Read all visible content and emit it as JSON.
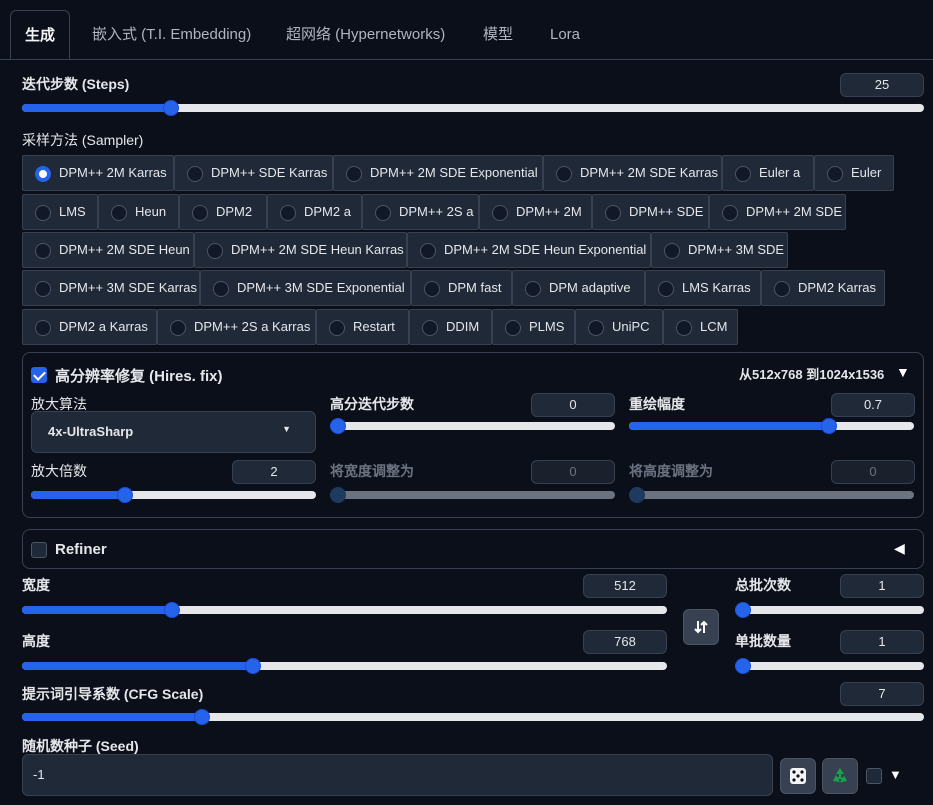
{
  "tabs": [
    {
      "label": "生成",
      "active": true
    },
    {
      "label": "嵌入式 (T.I. Embedding)"
    },
    {
      "label": "超网络 (Hypernetworks)"
    },
    {
      "label": "模型"
    },
    {
      "label": "Lora"
    }
  ],
  "steps": {
    "label": "迭代步数 (Steps)",
    "value": "25",
    "fraction": 0.165
  },
  "sampler": {
    "label": "采样方法 (Sampler)",
    "selected": "DPM++ 2M Karras",
    "options": [
      "DPM++ 2M Karras",
      "DPM++ SDE Karras",
      "DPM++ 2M SDE Exponential",
      "DPM++ 2M SDE Karras",
      "Euler a",
      "Euler",
      "LMS",
      "Heun",
      "DPM2",
      "DPM2 a",
      "DPM++ 2S a",
      "DPM++ 2M",
      "DPM++ SDE",
      "DPM++ 2M SDE",
      "DPM++ 2M SDE Heun",
      "DPM++ 2M SDE Heun Karras",
      "DPM++ 2M SDE Heun Exponential",
      "DPM++ 3M SDE",
      "DPM++ 3M SDE Karras",
      "DPM++ 3M SDE Exponential",
      "DPM fast",
      "DPM adaptive",
      "LMS Karras",
      "DPM2 Karras",
      "DPM2 a Karras",
      "DPM++ 2S a Karras",
      "Restart",
      "DDIM",
      "PLMS",
      "UniPC",
      "LCM"
    ]
  },
  "hires": {
    "title": "高分辨率修复 (Hires. fix)",
    "enabled": true,
    "summary": "从512x768 到1024x1536",
    "upscaler_label": "放大算法",
    "upscaler_value": "4x-UltraSharp",
    "hires_steps_label": "高分迭代步数",
    "hires_steps_value": "0",
    "hires_steps_fraction": 0.0,
    "denoise_label": "重绘幅度",
    "denoise_value": "0.7",
    "denoise_fraction": 0.7,
    "scale_label": "放大倍数",
    "scale_value": "2",
    "scale_fraction": 0.33,
    "resize_w_label": "将宽度调整为",
    "resize_w_value": "0",
    "resize_h_label": "将高度调整为",
    "resize_h_value": "0"
  },
  "refiner": {
    "label": "Refiner",
    "enabled": false
  },
  "width": {
    "label": "宽度",
    "value": "512",
    "fraction": 0.233
  },
  "height": {
    "label": "高度",
    "value": "768",
    "fraction": 0.358
  },
  "batch_count": {
    "label": "总批次数",
    "value": "1",
    "fraction": 0.0
  },
  "batch_size": {
    "label": "单批数量",
    "value": "1",
    "fraction": 0.0
  },
  "cfg": {
    "label": "提示词引导系数 (CFG Scale)",
    "value": "7",
    "fraction": 0.2
  },
  "seed": {
    "label": "随机数种子 (Seed)",
    "value": "-1"
  },
  "colors": {
    "accent": "#2563eb",
    "background": "#0b0f19",
    "surface": "#1f2937",
    "border": "#374151"
  }
}
